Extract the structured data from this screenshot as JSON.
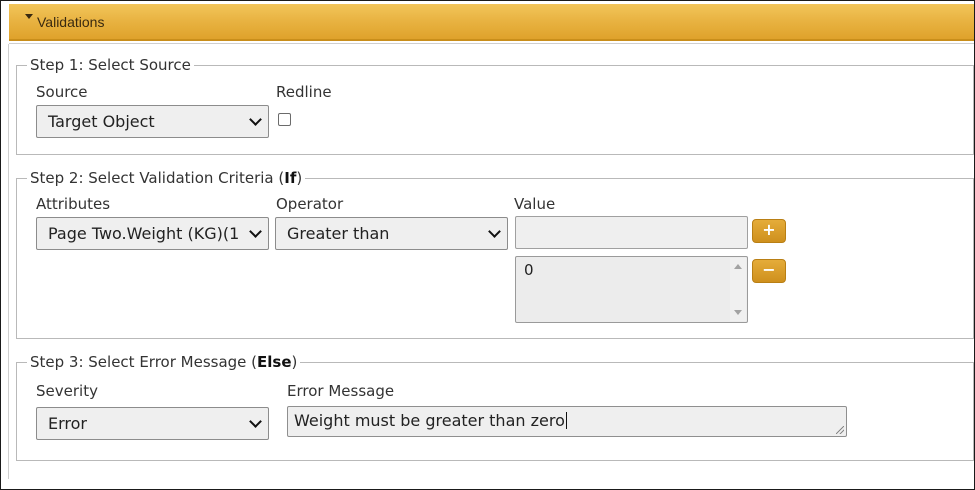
{
  "panel": {
    "title": "Validations"
  },
  "step1": {
    "legend": "Step 1: Select Source",
    "source_label": "Source",
    "source_value": "Target Object",
    "redline_label": "Redline",
    "redline_checked": false
  },
  "step2": {
    "legend_prefix": "Step 2: Select Validation Criteria (",
    "legend_bold": "If",
    "legend_suffix": ")",
    "attributes_label": "Attributes",
    "attributes_value": "Page Two.Weight (KG)(1",
    "operator_label": "Operator",
    "operator_value": "Greater than",
    "value_label": "Value",
    "value_input": "",
    "add_label": "+",
    "remove_label": "−",
    "values_list": "0"
  },
  "step3": {
    "legend_prefix": "Step 3: Select Error Message (",
    "legend_bold": "Else",
    "legend_suffix": ")",
    "severity_label": "Severity",
    "severity_value": "Error",
    "error_message_label": "Error Message",
    "error_message_value": "Weight must be greater than zero"
  },
  "colors": {
    "header_gold": "#e9b443",
    "button_gold": "#d9991f"
  }
}
